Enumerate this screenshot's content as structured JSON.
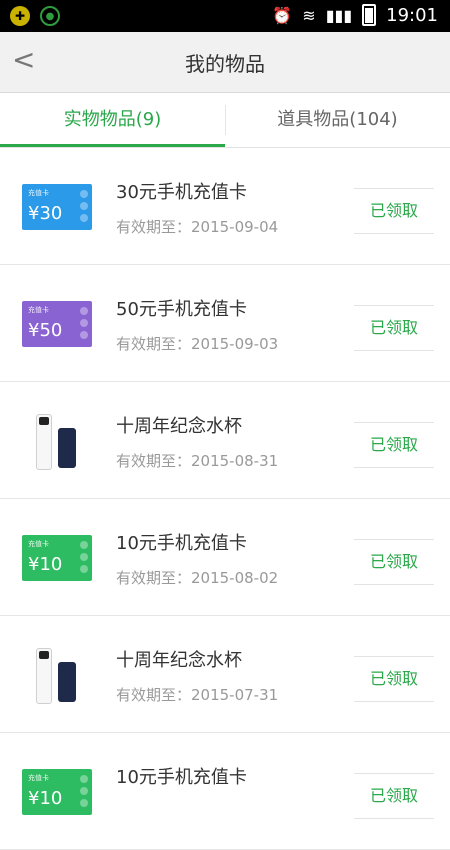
{
  "status_bar": {
    "time": "19:01"
  },
  "header": {
    "back_symbol": "<",
    "title": "我的物品"
  },
  "tabs": [
    {
      "label": "实物物品(9)",
      "active": true
    },
    {
      "label": "道具物品(104)",
      "active": false
    }
  ],
  "items": [
    {
      "type": "card",
      "card_value": "¥30",
      "card_color": "#2b9ae8",
      "name": "30元手机充值卡",
      "expiry": "有效期至：2015-09-04",
      "action": "已领取"
    },
    {
      "type": "card",
      "card_value": "¥50",
      "card_color": "#8a63d2",
      "name": "50元手机充值卡",
      "expiry": "有效期至：2015-09-03",
      "action": "已领取"
    },
    {
      "type": "bottle",
      "name": "十周年纪念水杯",
      "expiry": "有效期至：2015-08-31",
      "action": "已领取"
    },
    {
      "type": "card",
      "card_value": "¥10",
      "card_color": "#2ebc62",
      "name": "10元手机充值卡",
      "expiry": "有效期至：2015-08-02",
      "action": "已领取"
    },
    {
      "type": "bottle",
      "name": "十周年纪念水杯",
      "expiry": "有效期至：2015-07-31",
      "action": "已领取"
    },
    {
      "type": "card",
      "card_value": "¥10",
      "card_color": "#2ebc62",
      "name": "10元手机充值卡",
      "expiry": "",
      "action": "已领取"
    }
  ],
  "colors": {
    "accent": "#2aa84a"
  },
  "icons": {
    "status_left": [
      "app-icon",
      "contact-icon"
    ],
    "status_right": [
      "alarm-icon",
      "wifi-icon",
      "signal-icon",
      "battery-icon"
    ]
  }
}
